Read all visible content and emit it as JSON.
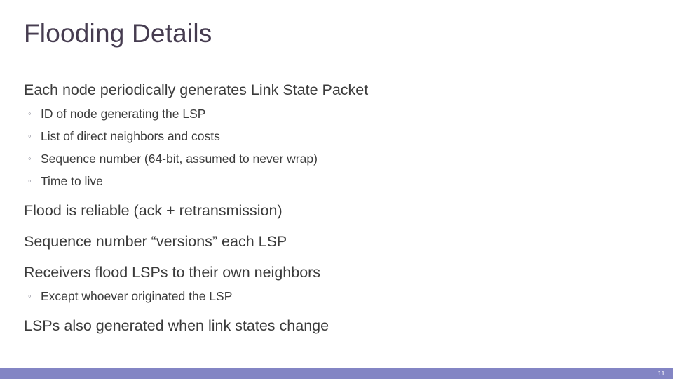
{
  "slide": {
    "title": "Flooding Details",
    "title_color": "#463C50",
    "background_color": "#FFFFFF",
    "body_text_color": "#3B3B3B",
    "accent_color": "#8385C4",
    "sub_bullet_marker": "◦",
    "number": "11",
    "bullets": [
      {
        "level": 1,
        "text": "Each node periodically generates Link State Packet"
      },
      {
        "level": 2,
        "text": "ID of node generating the LSP"
      },
      {
        "level": 2,
        "text": "List of direct neighbors and costs"
      },
      {
        "level": 2,
        "text": "Sequence number (64-bit, assumed to never wrap)"
      },
      {
        "level": 2,
        "text": "Time to live"
      },
      {
        "level": 1,
        "text": "Flood is reliable (ack + retransmission)"
      },
      {
        "level": 1,
        "text": "Sequence number “versions” each LSP"
      },
      {
        "level": 1,
        "text": "Receivers flood LSPs to their own neighbors"
      },
      {
        "level": 2,
        "text": "Except whoever originated the LSP"
      },
      {
        "level": 1,
        "text": "LSPs also generated when link states change"
      }
    ]
  }
}
